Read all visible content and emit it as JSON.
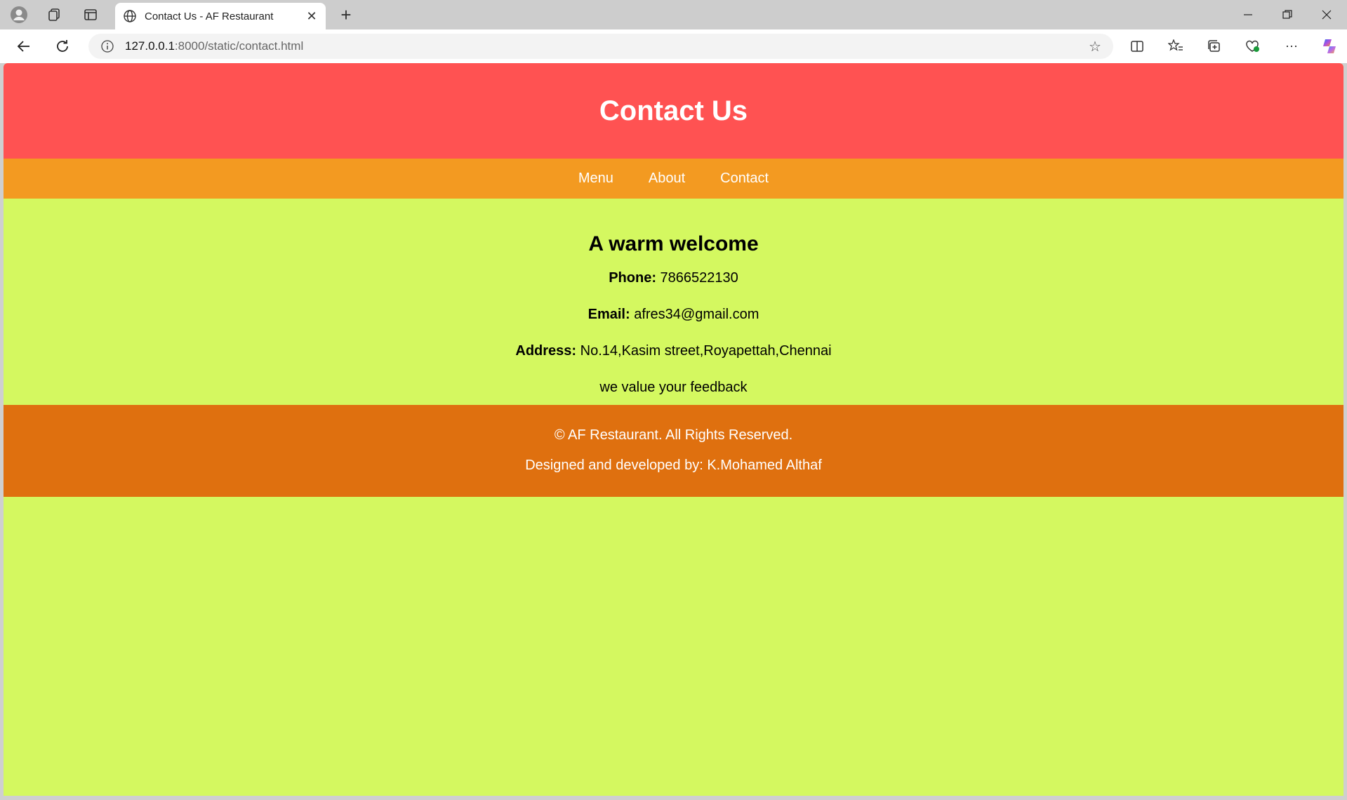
{
  "browser": {
    "tab_title": "Contact Us - AF Restaurant",
    "url_host": "127.0.0.1",
    "url_path": ":8000/static/contact.html",
    "icons": [
      "profile-icon",
      "workspaces-icon",
      "tab-actions-icon",
      "globe-icon",
      "close-icon",
      "new-tab-icon",
      "minimize-icon",
      "restore-icon",
      "window-close-icon",
      "back-icon",
      "refresh-icon",
      "info-icon",
      "favorite-star-icon",
      "split-screen-icon",
      "favorites-icon",
      "collections-icon",
      "browser-essentials-icon",
      "more-icon",
      "copilot-icon"
    ]
  },
  "page": {
    "header_title": "Contact Us",
    "nav": [
      {
        "label": "Menu"
      },
      {
        "label": "About"
      },
      {
        "label": "Contact"
      }
    ],
    "heading": "A warm welcome",
    "phone_label": "Phone:",
    "phone_value": "7866522130",
    "email_label": "Email:",
    "email_value": "afres34@gmail.com",
    "address_label": "Address:",
    "address_value": "No.14,Kasim street,Royapettah,Chennai",
    "feedback_text": "we value your feedback",
    "footer_copyright": "© AF Restaurant. All Rights Reserved.",
    "footer_credit": "Designed and developed by: K.Mohamed Althaf"
  },
  "colors": {
    "header": "#ff5252",
    "nav": "#f39a21",
    "body": "#d4f860",
    "footer": "#df700f"
  }
}
